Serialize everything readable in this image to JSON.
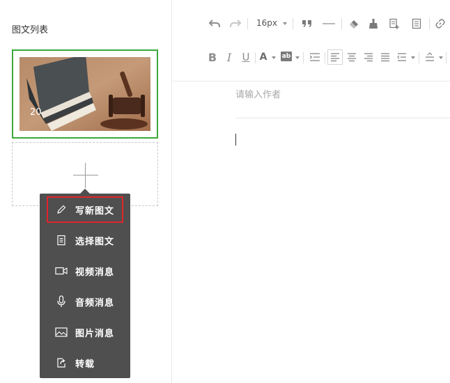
{
  "sidebar": {
    "title": "图文列表",
    "article": {
      "count": "20"
    }
  },
  "add_menu": {
    "items": [
      {
        "label": "写新图文",
        "icon": "pencil-icon"
      },
      {
        "label": "选择图文",
        "icon": "document-icon"
      },
      {
        "label": "视频消息",
        "icon": "video-camera-icon"
      },
      {
        "label": "音频消息",
        "icon": "microphone-icon"
      },
      {
        "label": "图片消息",
        "icon": "image-icon"
      },
      {
        "label": "转载",
        "icon": "share-icon"
      }
    ]
  },
  "toolbar": {
    "font_size": "16px"
  },
  "editor": {
    "author_placeholder": "请输入作者"
  },
  "colors": {
    "selected_border": "#3aa83a",
    "highlight_border": "#e0242b",
    "menu_bg": "#4f4f4f"
  }
}
